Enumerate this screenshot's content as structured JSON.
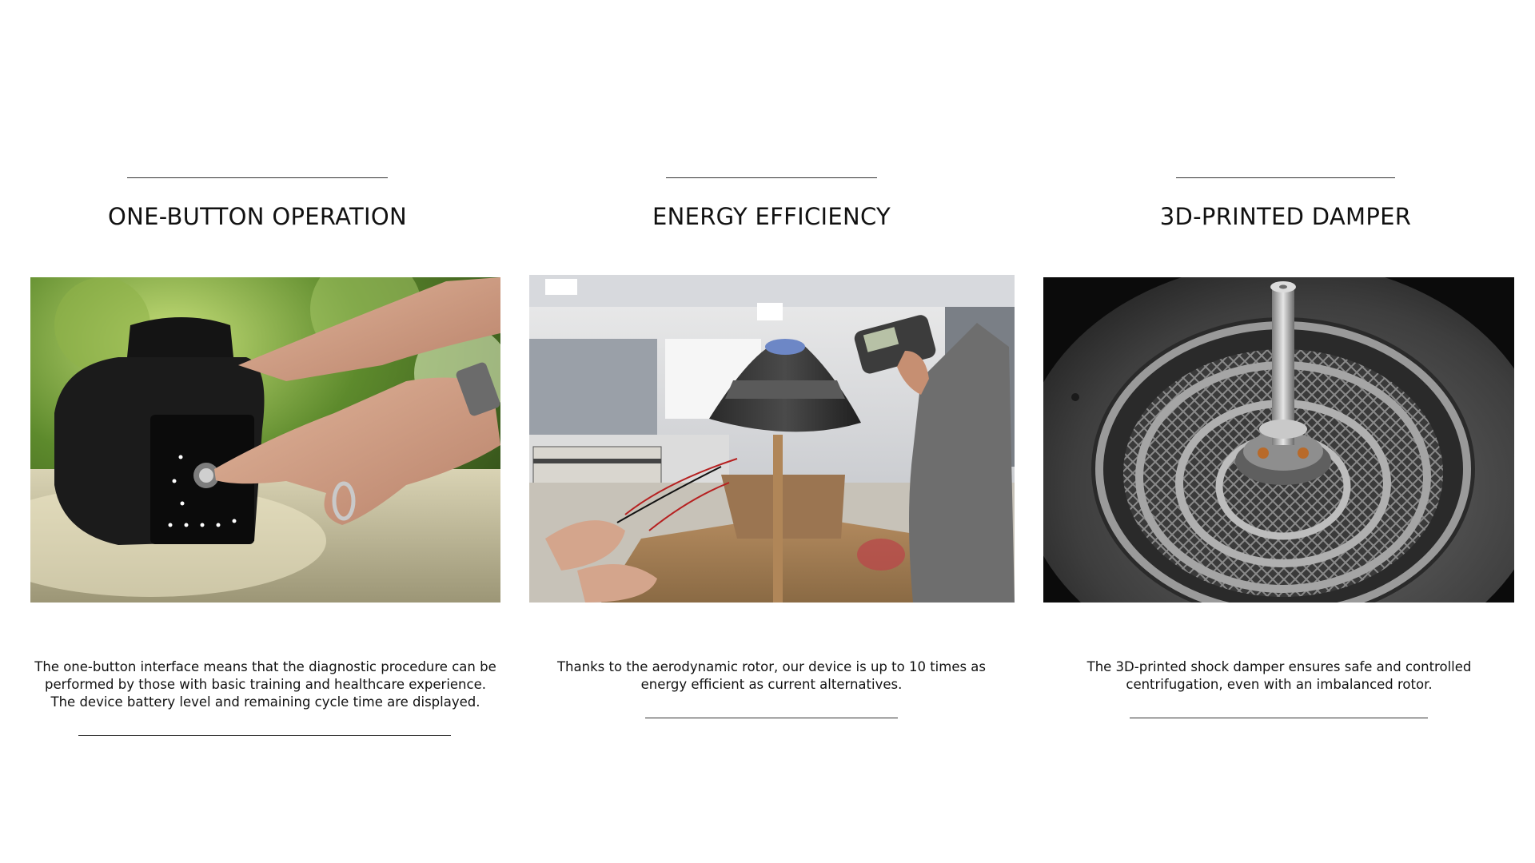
{
  "features": [
    {
      "title": "ONE-BUTTON OPERATION",
      "image_subject": "hand pressing the single button on a black centrifuge device outdoors",
      "description": "The one-button interface means that the diagnostic procedure can be performed by those with basic training and healthcare experience. The device battery level and remaining cycle time are displayed."
    },
    {
      "title": "ENERGY EFFICIENCY",
      "image_subject": "laboratory bench with conical rotor test rig and handheld tachometer",
      "description": "Thanks to the aerodynamic rotor, our device is up to 10 times as energy efficient as current alternatives."
    },
    {
      "title": "3D-PRINTED DAMPER",
      "image_subject": "close-up of a spiral 3D-printed lattice shock damper around a motor shaft",
      "description": "The 3D-printed shock damper ensures safe and controlled centrifugation, even with an imbalanced rotor."
    }
  ],
  "colors": {
    "rule": "#333333",
    "text": "#111111",
    "background": "#ffffff"
  }
}
